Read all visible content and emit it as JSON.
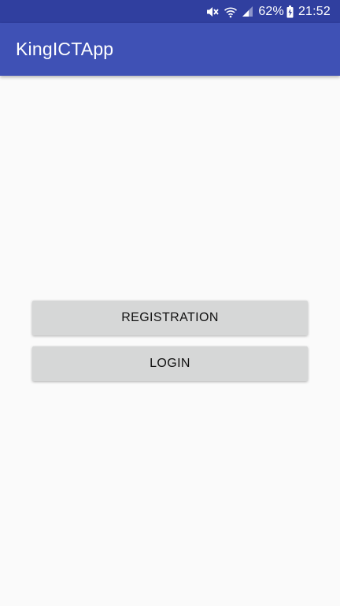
{
  "status_bar": {
    "battery_percent": "62%",
    "time": "21:52",
    "icons": [
      "mute-icon",
      "wifi-icon",
      "signal-icon",
      "battery-charging-icon"
    ]
  },
  "app_bar": {
    "title": "KingICTApp",
    "color": "#3f51b5"
  },
  "buttons": {
    "registration_label": "REGISTRATION",
    "login_label": "LOGIN"
  }
}
